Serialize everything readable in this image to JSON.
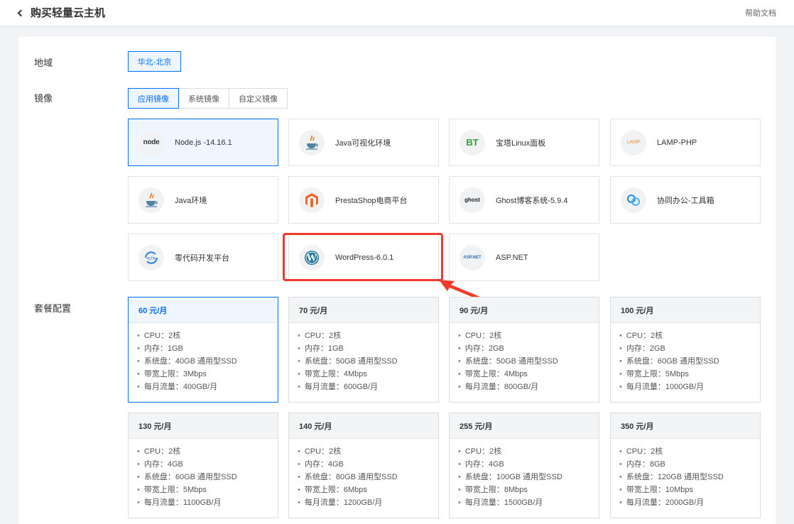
{
  "header": {
    "title": "购买轻量云主机",
    "help": "帮助文档"
  },
  "labels": {
    "region": "地域",
    "image": "镜像",
    "plan": "套餐配置"
  },
  "region": {
    "selected": "华北-北京"
  },
  "image_tabs": [
    "应用镜像",
    "系统镜像",
    "自定义镜像"
  ],
  "images": [
    {
      "name": "Node.js -14.16.1",
      "icon": "node",
      "selected": true
    },
    {
      "name": "Java可视化环境",
      "icon": "java"
    },
    {
      "name": "宝塔Linux面板",
      "icon": "bt"
    },
    {
      "name": "LAMP-PHP",
      "icon": "lamp"
    },
    {
      "name": "Java环境",
      "icon": "java"
    },
    {
      "name": "PrestaShop电商平台",
      "icon": "magento"
    },
    {
      "name": "Ghost博客系统-5.9.4",
      "icon": "ghost"
    },
    {
      "name": "协同办公-工具箱",
      "icon": "link"
    },
    {
      "name": "零代码开发平台",
      "icon": "code"
    },
    {
      "name": "WordPress-6.0.1",
      "icon": "wordpress"
    },
    {
      "name": "ASP.NET",
      "icon": "aspnet"
    }
  ],
  "icon_text": {
    "node": "node",
    "bt": "BT",
    "lamp": "LAMP",
    "ghost": "ghost",
    "aspnet": "ASP.NET",
    "code": "</>",
    "wordpress": "W"
  },
  "plans": [
    {
      "price": "60 元/月",
      "selected": true,
      "specs": [
        "CPU：2核",
        "内存：1GB",
        "系统盘：40GB 通用型SSD",
        "带宽上限：3Mbps",
        "每月流量：400GB/月"
      ]
    },
    {
      "price": "70 元/月",
      "specs": [
        "CPU：2核",
        "内存：1GB",
        "系统盘：50GB 通用型SSD",
        "带宽上限：4Mbps",
        "每月流量：600GB/月"
      ]
    },
    {
      "price": "90 元/月",
      "specs": [
        "CPU：2核",
        "内存：2GB",
        "系统盘：50GB 通用型SSD",
        "带宽上限：4Mbps",
        "每月流量：800GB/月"
      ]
    },
    {
      "price": "100 元/月",
      "specs": [
        "CPU：2核",
        "内存：2GB",
        "系统盘：60GB 通用型SSD",
        "带宽上限：5Mbps",
        "每月流量：1000GB/月"
      ]
    },
    {
      "price": "130 元/月",
      "specs": [
        "CPU：2核",
        "内存：4GB",
        "系统盘：60GB 通用型SSD",
        "带宽上限：5Mbps",
        "每月流量：1100GB/月"
      ]
    },
    {
      "price": "140 元/月",
      "specs": [
        "CPU：2核",
        "内存：4GB",
        "系统盘：80GB 通用型SSD",
        "带宽上限：6Mbps",
        "每月流量：1200GB/月"
      ]
    },
    {
      "price": "255 元/月",
      "specs": [
        "CPU：2核",
        "内存：4GB",
        "系统盘：100GB 通用型SSD",
        "带宽上限：8Mbps",
        "每月流量：1500GB/月"
      ]
    },
    {
      "price": "350 元/月",
      "specs": [
        "CPU：2核",
        "内存：8GB",
        "系统盘：120GB 通用型SSD",
        "带宽上限：10Mbps",
        "每月流量：2000GB/月"
      ]
    }
  ],
  "colors": {
    "accent": "#006eff",
    "annotation": "#f03a2b"
  }
}
